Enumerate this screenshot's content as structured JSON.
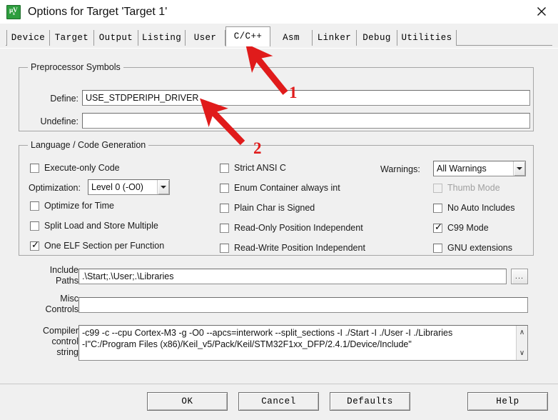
{
  "window": {
    "title": "Options for Target 'Target 1'",
    "icon": "uvision-logo-icon",
    "close_label": "×"
  },
  "tabs": [
    {
      "label": "Device",
      "active": false
    },
    {
      "label": "Target",
      "active": false
    },
    {
      "label": "Output",
      "active": false
    },
    {
      "label": "Listing",
      "active": false
    },
    {
      "label": "User",
      "active": false
    },
    {
      "label": "C/C++",
      "active": true
    },
    {
      "label": "Asm",
      "active": false
    },
    {
      "label": "Linker",
      "active": false
    },
    {
      "label": "Debug",
      "active": false
    },
    {
      "label": "Utilities",
      "active": false
    }
  ],
  "preprocessor": {
    "legend": "Preprocessor Symbols",
    "define_label": "Define:",
    "define_value": "USE_STDPERIPH_DRIVER",
    "undefine_label": "Undefine:",
    "undefine_value": ""
  },
  "language": {
    "legend": "Language / Code Generation",
    "col1": [
      {
        "label": "Execute-only Code",
        "checked": false,
        "disabled": false
      },
      {
        "label": "Optimize for Time",
        "checked": false,
        "disabled": false
      },
      {
        "label": "Split Load and Store Multiple",
        "checked": false,
        "disabled": false
      },
      {
        "label": "One ELF Section per Function",
        "checked": true,
        "disabled": false
      }
    ],
    "optimization_label": "Optimization:",
    "optimization_value": "Level 0 (-O0)",
    "col2": [
      {
        "label": "Strict ANSI C",
        "checked": false,
        "disabled": false
      },
      {
        "label": "Enum Container always int",
        "checked": false,
        "disabled": false
      },
      {
        "label": "Plain Char is Signed",
        "checked": false,
        "disabled": false
      },
      {
        "label": "Read-Only Position Independent",
        "checked": false,
        "disabled": false
      },
      {
        "label": "Read-Write Position Independent",
        "checked": false,
        "disabled": false
      }
    ],
    "warnings_label": "Warnings:",
    "warnings_value": "All Warnings",
    "col3": [
      {
        "label": "Thumb Mode",
        "checked": false,
        "disabled": true
      },
      {
        "label": "No Auto Includes",
        "checked": false,
        "disabled": false
      },
      {
        "label": "C99 Mode",
        "checked": true,
        "disabled": false
      },
      {
        "label": "GNU extensions",
        "checked": false,
        "disabled": false
      }
    ]
  },
  "paths": {
    "include_label_line1": "Include",
    "include_label_line2": "Paths",
    "include_value": ".\\Start;.\\User;.\\Libraries",
    "browse_label": "...",
    "misc_label_line1": "Misc",
    "misc_label_line2": "Controls",
    "misc_value": "",
    "compiler_label_line1": "Compiler",
    "compiler_label_line2": "control",
    "compiler_label_line3": "string",
    "compiler_line1": "-c99 -c --cpu Cortex-M3 -g -O0 --apcs=interwork --split_sections -I ./Start -I ./User -I ./Libraries",
    "compiler_line2": "-I\"C:/Program Files (x86)/Keil_v5/Pack/Keil/STM32F1xx_DFP/2.4.1/Device/Include\"",
    "scroll_up": "∧",
    "scroll_down": "∨"
  },
  "buttons": {
    "ok": "OK",
    "cancel": "Cancel",
    "defaults": "Defaults",
    "help": "Help"
  },
  "annotations": {
    "color": "#e01b1b",
    "marks": [
      {
        "number": "1",
        "points_to": "C/C++ tab"
      },
      {
        "number": "2",
        "points_to": "Define field"
      }
    ]
  }
}
